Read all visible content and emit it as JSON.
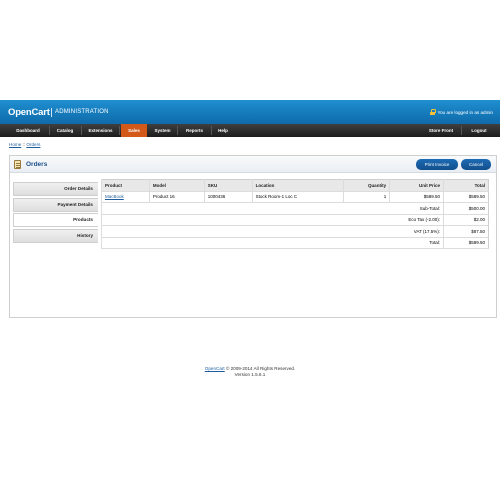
{
  "header": {
    "logo": "OpenCart",
    "subtitle": "ADMINISTRATION",
    "login_text": "You are logged in as admin"
  },
  "nav": {
    "items": [
      "Dashboard",
      "Catalog",
      "Extensions",
      "Sales",
      "System",
      "Reports",
      "Help"
    ],
    "active": "Sales",
    "store_front": "Store Front",
    "logout": "Logout"
  },
  "breadcrumb": {
    "home": "Home",
    "sep": " :: ",
    "current": "Orders"
  },
  "panel": {
    "title": "Orders",
    "print_invoice": "Print Invoice",
    "cancel": "Cancel"
  },
  "tabs": [
    "Order Details",
    "Payment Details",
    "Products",
    "History"
  ],
  "active_tab": "Products",
  "products": {
    "columns": [
      "Product",
      "Model",
      "SKU",
      "Location",
      "Quantity",
      "Unit Price",
      "Total"
    ],
    "rows": [
      {
        "product": "MacBook",
        "model": "Product 16",
        "sku": "1000436",
        "location": "Stock Room-1 Loc C",
        "quantity": "1",
        "unit_price": "$589.50",
        "total": "$589.50"
      }
    ],
    "totals": [
      {
        "label": "Sub-Total:",
        "value": "$500.00"
      },
      {
        "label": "Eco Tax (-2.00):",
        "value": "$2.00"
      },
      {
        "label": "VAT (17.5%):",
        "value": "$87.50"
      },
      {
        "label": "Total:",
        "value": "$589.50"
      }
    ]
  },
  "footer": {
    "link": "OpenCart",
    "copyright": " © 2009-2014 All Rights Reserved.",
    "version": "Version 1.5.6.1"
  },
  "colors": {
    "header_blue": "#1f8fd0",
    "nav_active": "#d2591a",
    "button_blue": "#1c6bb5"
  }
}
